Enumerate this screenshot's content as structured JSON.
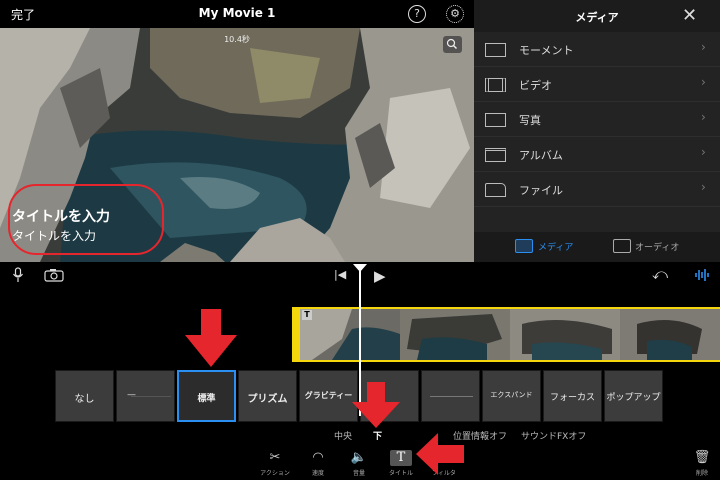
{
  "topbar": {
    "done_label": "完了",
    "title": "My Movie 1",
    "help_icon": "help-icon",
    "settings_icon": "gear-icon"
  },
  "viewer": {
    "duration": "10.4秒",
    "title_main": "タイトルを入力",
    "title_sub": "タイトルを入力"
  },
  "media": {
    "title": "メディア",
    "items": [
      {
        "label": "モーメント",
        "icon": "moments-icon"
      },
      {
        "label": "ビデオ",
        "icon": "video-icon"
      },
      {
        "label": "写真",
        "icon": "photo-icon"
      },
      {
        "label": "アルバム",
        "icon": "album-icon"
      },
      {
        "label": "ファイル",
        "icon": "folder-icon"
      }
    ],
    "tabs": [
      {
        "label": "メディア",
        "active": true
      },
      {
        "label": "オーディオ",
        "active": false
      }
    ]
  },
  "styles": {
    "items": [
      {
        "label": "なし"
      },
      {
        "label": "―"
      },
      {
        "label": "標準",
        "selected": true
      },
      {
        "label": "プリズム"
      },
      {
        "label": "グラビティー"
      },
      {
        "label": ""
      },
      {
        "label": ""
      },
      {
        "label": "エクスパンド"
      },
      {
        "label": "フォーカス"
      },
      {
        "label": "ポップアップ"
      }
    ]
  },
  "options": {
    "center": "中央",
    "bottom": "下",
    "location": "位置情報オフ",
    "sound": "サウンドFXオフ"
  },
  "toolbar": {
    "action": "アクション",
    "speed": "速度",
    "volume": "音量",
    "title": "タイトル",
    "filter": "フィルタ",
    "delete": "削除"
  },
  "colors": {
    "accent": "#2a8ff0",
    "clip_border": "#f5d50c",
    "annotation_red": "#e6262d"
  }
}
